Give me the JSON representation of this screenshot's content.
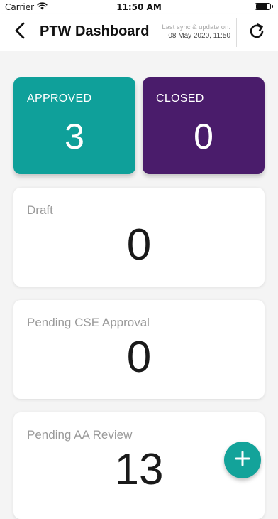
{
  "status_bar": {
    "carrier": "Carrier",
    "time": "11:50 AM",
    "battery_level": 0.95
  },
  "header": {
    "title": "PTW Dashboard",
    "sync_label": "Last sync & update on:",
    "sync_time": "08 May 2020, 11:50",
    "icons": {
      "back": "chevron-left-icon",
      "refresh": "refresh-icon"
    }
  },
  "summary": {
    "approved": {
      "label": "APPROVED",
      "count": "3",
      "color": "#0fa09a"
    },
    "closed": {
      "label": "CLOSED",
      "count": "0",
      "color": "#4a1c6b"
    }
  },
  "cards": [
    {
      "label": "Draft",
      "count": "0"
    },
    {
      "label": "Pending CSE Approval",
      "count": "0"
    },
    {
      "label": "Pending AA Review",
      "count": "13"
    }
  ],
  "fab": {
    "icon": "plus-icon",
    "color": "#13a39a"
  }
}
